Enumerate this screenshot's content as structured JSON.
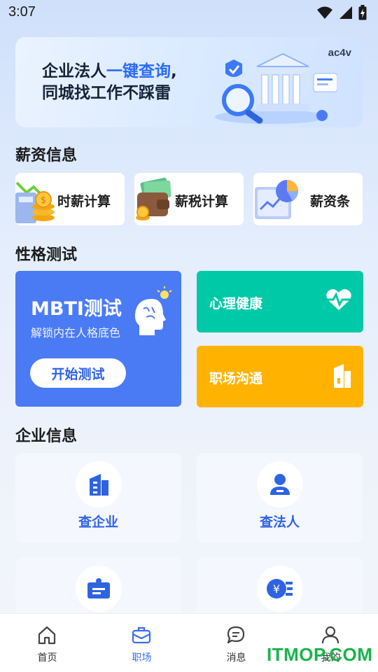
{
  "status_bar": {
    "time": "3:07"
  },
  "banner": {
    "line1_prefix": "企业法人",
    "line1_highlight": "一键查询",
    "line1_suffix": ",",
    "line2": "同城找工作不踩雷",
    "tag": "ac4v"
  },
  "salary_section": {
    "title": "薪资信息",
    "items": [
      {
        "label": "时薪计算",
        "icon": "coins-chart-icon"
      },
      {
        "label": "薪税计算",
        "icon": "wallet-money-icon"
      },
      {
        "label": "薪资条",
        "icon": "pie-chart-report-icon"
      }
    ]
  },
  "personality_section": {
    "title": "性格测试",
    "mbti": {
      "title": "MBTI测试",
      "subtitle": "解锁内在人格底色",
      "button": "开始测试",
      "color": "#4a7bf4"
    },
    "mental_health": {
      "label": "心理健康",
      "color": "#00c9a7",
      "icon": "heartbeat-icon"
    },
    "workplace": {
      "label": "职场沟通",
      "color": "#ffb300",
      "icon": "building-icon"
    }
  },
  "enterprise_section": {
    "title": "企业信息",
    "items": [
      {
        "label": "查企业",
        "icon": "company-building-icon"
      },
      {
        "label": "查法人",
        "icon": "person-icon"
      },
      {
        "label": "",
        "icon": "id-badge-icon"
      },
      {
        "label": "",
        "icon": "yen-list-icon"
      }
    ]
  },
  "tabbar": {
    "tabs": [
      {
        "label": "首页",
        "icon": "home-icon"
      },
      {
        "label": "职场",
        "icon": "briefcase-icon",
        "active": true
      },
      {
        "label": "消息",
        "icon": "chat-icon"
      },
      {
        "label": "我的",
        "icon": "user-icon"
      }
    ]
  },
  "watermark": "ITMOP.COM",
  "colors": {
    "accent": "#3a6ef0",
    "enterprise_text": "#2f64e0"
  }
}
